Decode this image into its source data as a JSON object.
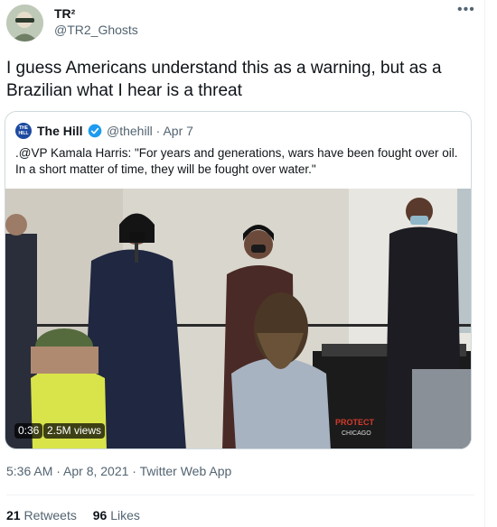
{
  "user": {
    "name": "TR²",
    "handle": "@TR2_Ghosts"
  },
  "tweet": {
    "text": "I guess Americans understand this as a warning, but as a Brazilian what I hear is a threat",
    "timestamp": "5:36 AM · Apr 8, 2021 · Twitter Web App"
  },
  "quoted": {
    "logo_text": "THE HILL",
    "name": "The Hill",
    "handle": "@thehill · Apr 7",
    "text": ".@VP Kamala Harris: \"For years and generations, wars have been fought over oil. In a short matter of time, they will be fought over water.\"",
    "video": {
      "duration": "0:36",
      "views": "2.5M views"
    }
  },
  "stats": {
    "retweets_count": "21",
    "retweets_label": "Retweets",
    "likes_count": "96",
    "likes_label": "Likes"
  },
  "menu_icon": "more-horizontal-icon",
  "colors": {
    "verified": "#1d9bf0",
    "secondary_text": "#536471",
    "primary_text": "#0f1419",
    "border": "#cfd9de"
  }
}
